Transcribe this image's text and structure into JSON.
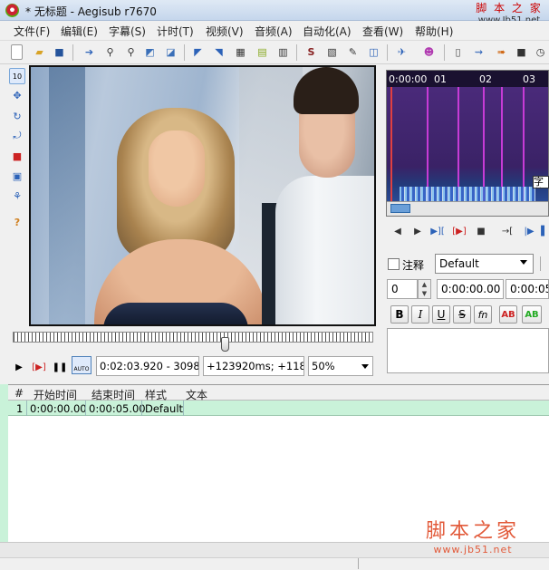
{
  "window": {
    "title": "* 无标题 - Aegisub r7670"
  },
  "watermark": {
    "top_text": "脚 本 之 家",
    "top_url": "www.Jb51.net",
    "bottom_text": "脚本之家",
    "bottom_url": "www.jb51.net"
  },
  "menu": [
    "文件(F)",
    "编辑(E)",
    "字幕(S)",
    "计时(T)",
    "视频(V)",
    "音频(A)",
    "自动化(A)",
    "查看(W)",
    "帮助(H)"
  ],
  "toolbar_icons": [
    "new-file-icon",
    "open-folder-icon",
    "save-icon",
    "jump-icon",
    "zoom-in-icon",
    "zoom-out-icon",
    "select-icon",
    "export-icon",
    "style-manager-icon",
    "attachments-icon",
    "fonts-icon",
    "video-icon",
    "audio-icon",
    "automation-icon",
    "translate-icon",
    "spell-check-icon",
    "resample-icon",
    "timing-icon",
    "options-icon",
    "help-icon",
    "clock-icon"
  ],
  "left_tools": [
    "standard-tool-icon",
    "move-tool-icon",
    "rotate-z-icon",
    "rotate-xy-icon",
    "scale-icon",
    "clip-icon",
    "vector-clip-icon",
    "help-icon"
  ],
  "video_controls": {
    "time": "0:02:03.920 - 3098",
    "offset": "+123920ms; +118",
    "zoom": "50%",
    "auto_label": "AUTO"
  },
  "audio": {
    "ruler": [
      "0:00:00",
      "01",
      "02",
      "03"
    ],
    "tooltip": "字幕"
  },
  "edit": {
    "comment_label": "注释",
    "style": "Default",
    "layer": "0",
    "start_time": "0:00:00.00",
    "end_time": "0:00:05",
    "format_buttons": [
      "B",
      "I",
      "U",
      "S",
      "fn",
      "AB",
      "AB"
    ]
  },
  "grid": {
    "columns": [
      "#",
      "开始时间",
      "结束时间",
      "样式",
      "文本"
    ],
    "rows": [
      {
        "num": "1",
        "start": "0:00:00.00",
        "end": "0:00:05.00",
        "style": "Default",
        "text": ""
      }
    ]
  },
  "colors": {
    "selected_row": "#c9f2d9",
    "audio_bg": "#2b1a4d",
    "audio_marker": "#c73bd6"
  }
}
